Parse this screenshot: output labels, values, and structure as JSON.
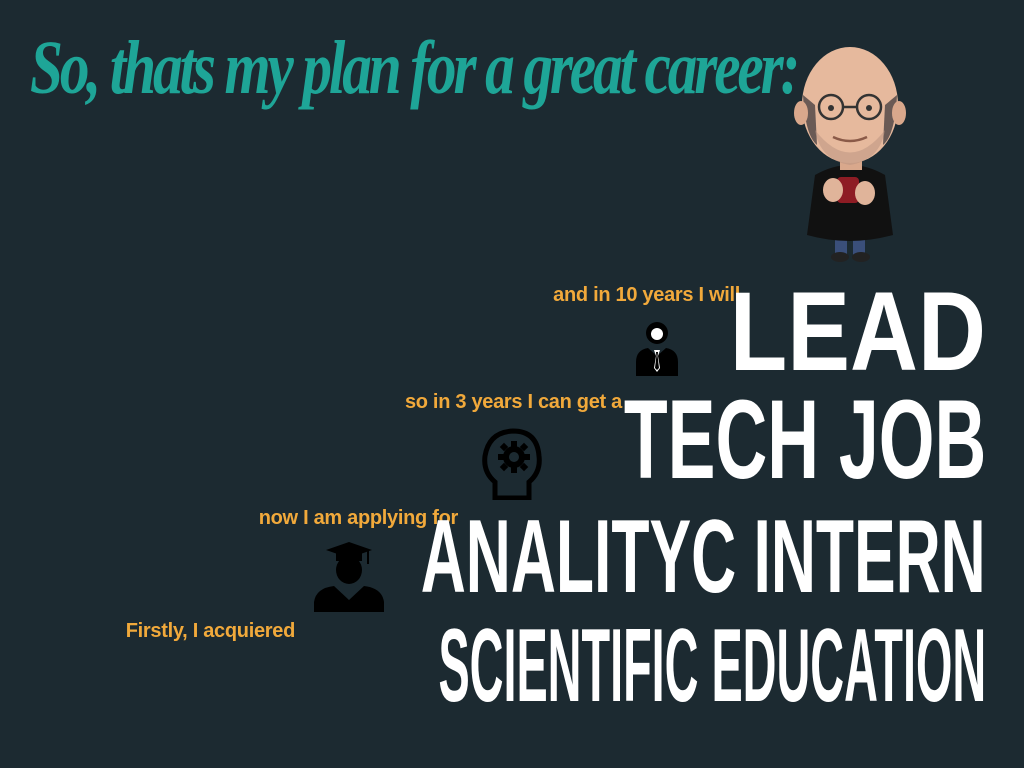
{
  "title": "So, thats my plan for a great career:",
  "steps": [
    {
      "lead_in": "and in 10 years I will",
      "headline": "LEAD",
      "icon": "businessman-icon"
    },
    {
      "lead_in": "so in 3 years I can get a",
      "headline": "TECH JOB",
      "icon": "head-gear-icon"
    },
    {
      "lead_in": "now I am applying for",
      "headline": "ANALITYC INTERN",
      "icon": "graduate-icon"
    },
    {
      "lead_in": "Firstly, I acquiered",
      "headline": "SCIENTIFIC EDUCATION",
      "icon": null
    }
  ],
  "illustration": "caricature-of-man-holding-cup",
  "colors": {
    "background": "#1c2a31",
    "title": "#1ea597",
    "lead_in": "#f1a93b",
    "headline": "#ffffff"
  }
}
